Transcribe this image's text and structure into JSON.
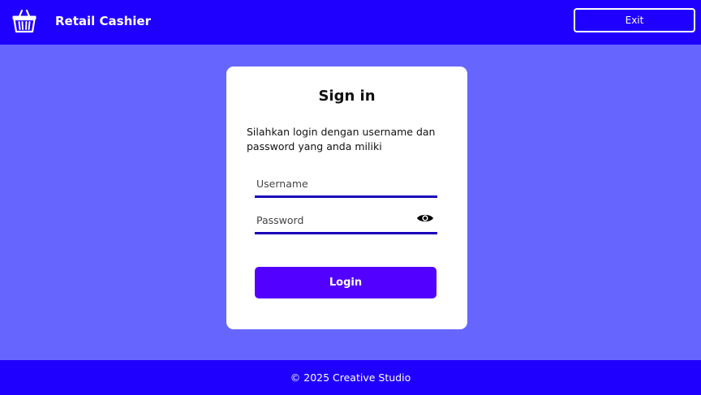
{
  "header": {
    "app_title": "Retail Cashier",
    "logo_icon": "shopping-basket-icon",
    "exit_label": "Exit"
  },
  "login": {
    "title": "Sign in",
    "description": "Silahkan login dengan username dan password yang anda miliki",
    "username_placeholder": "Username",
    "username_value": "",
    "password_placeholder": "Password",
    "password_value": "",
    "password_toggle_icon": "eye-icon",
    "login_label": "Login"
  },
  "footer": {
    "text": "© 2025 Creative Studio"
  },
  "colors": {
    "header_bg": "#1f00ff",
    "page_bg": "#6666ff",
    "card_bg": "#ffffff",
    "accent_underline": "#1a00b8",
    "login_button": "#5200ff"
  }
}
